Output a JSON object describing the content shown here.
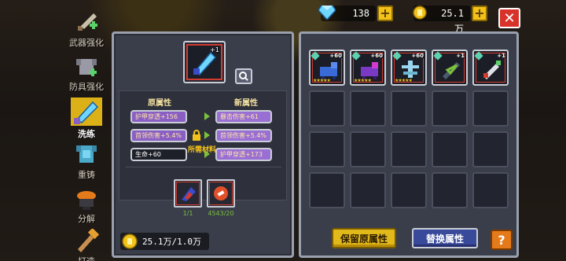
{
  "currency": {
    "gems": "138",
    "gold": "25.1万"
  },
  "nav": {
    "items": [
      {
        "label": "武器强化"
      },
      {
        "label": "防具强化"
      },
      {
        "label": "洗练"
      },
      {
        "label": "重铸"
      },
      {
        "label": "分解"
      },
      {
        "label": "打造"
      }
    ]
  },
  "reforge": {
    "item_level": "+1",
    "old_header": "原属性",
    "new_header": "新属性",
    "old_attrs": [
      "护甲穿透+156",
      "首领伤害+5.4%",
      "生命+60"
    ],
    "new_attrs": [
      "暴击伤害+61",
      "首领伤害+5.4%",
      "护甲穿透+173"
    ],
    "materials_label": "所需材料",
    "materials": [
      {
        "count": "1/1"
      },
      {
        "count": "4543/20"
      }
    ],
    "cost": "25.1万/1.0万"
  },
  "inventory": {
    "items": [
      {
        "up": "+60",
        "stars": "★★★★★"
      },
      {
        "up": "+60",
        "stars": "★★★★★"
      },
      {
        "up": "+60",
        "stars": "★★★★★"
      },
      {
        "up": "+1",
        "stars": ""
      },
      {
        "up": "+1",
        "stars": ""
      }
    ]
  },
  "buttons": {
    "keep": "保留原属性",
    "replace": "替换属性",
    "help": "?",
    "close": "✕"
  },
  "colors": {
    "accent_yellow": "#e2b91b",
    "panel": "#3a3e4a",
    "attr_purple": "#8a5fc4",
    "rarity_red": "#d23b2f"
  }
}
